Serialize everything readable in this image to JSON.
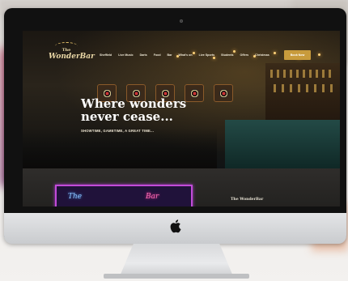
{
  "site": {
    "logo": {
      "line1": "The",
      "line2": "WonderBar"
    },
    "nav": {
      "items": [
        "Sheffield",
        "Live Music",
        "Darts",
        "Food",
        "Bar",
        "What's on",
        "Live Sports",
        "Students",
        "Offers",
        "Christmas"
      ],
      "cta": "Book Now"
    },
    "hero": {
      "headline_line1": "Where wonders",
      "headline_line2": "never cease...",
      "tagline": "SHOWTIME, GAMETIME, A GREAT TIME..."
    },
    "section": {
      "title": "The WonderBar",
      "neon_left": "The",
      "neon_right": "Bar"
    }
  },
  "icons": [
    "apple-logo-icon",
    "camera-icon"
  ],
  "colors": {
    "accent": "#c89b3c",
    "neon_frame": "#c24bd8",
    "bar_teal": "#234a46"
  }
}
